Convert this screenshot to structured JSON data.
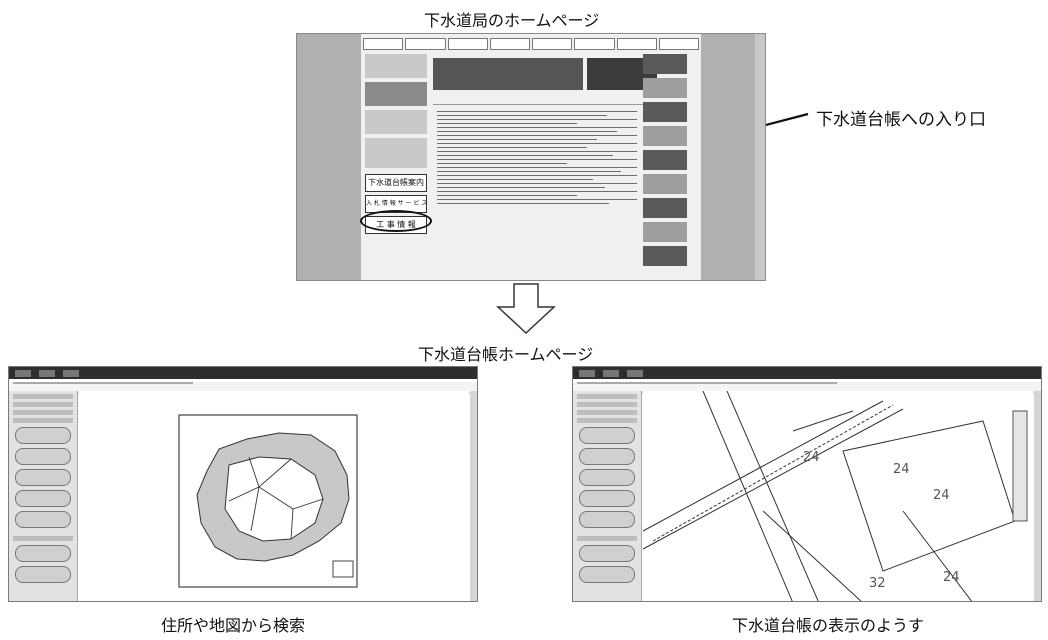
{
  "captions": {
    "top": "下水道局のホームページ",
    "entry": "下水道台帳への入り口",
    "middle": "下水道台帳ホームページ",
    "left_bottom": "住所や地図から検索",
    "right_bottom": "下水道台帳の表示のようす"
  },
  "homepage": {
    "highlighted_button": "下水道台帳案内",
    "left_buttons": [
      "入 札 情 報 サ ー ビ ス",
      "工 事 情 報"
    ]
  },
  "map_numbers": [
    "24",
    "24",
    "24",
    "32",
    "24"
  ],
  "colors": {
    "frame": "#7a7a7a",
    "banner_dark": "#3c3c3c",
    "region_gray": "#c8c8c8"
  }
}
